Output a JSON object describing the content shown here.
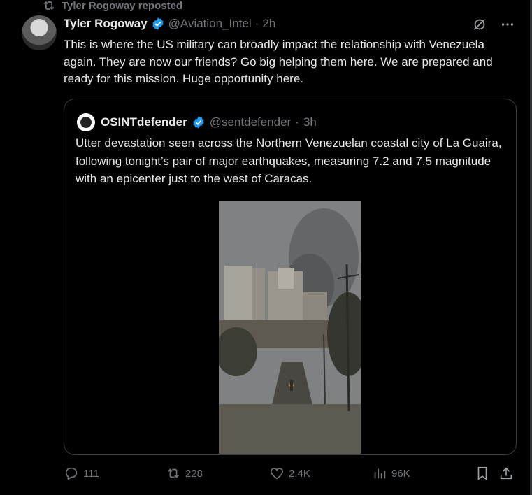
{
  "repost": {
    "label": "Tyler Rogoway reposted",
    "icon": "repost-icon"
  },
  "tweet": {
    "author_name": "Tyler Rogoway",
    "handle": "@Aviation_Intel",
    "separator": "·",
    "time": "2h",
    "text": "This is where the US military can broadly impact the relationship with Venezuela again. They are now our friends? Go big helping them here. We are prepared and ready for this mission. Huge opportunity here."
  },
  "quote": {
    "author_name": "OSINTdefender",
    "handle": "@sentdefender",
    "separator": "·",
    "time": "3h",
    "text": "Utter devastation seen across the Northern Venezuelan coastal city of La Guaira, following tonight’s pair of major earthquakes, measuring 7.2 and 7.5 magnitude with an epicenter just to the west of Caracas."
  },
  "actions": {
    "replies": "111",
    "reposts": "228",
    "likes": "2.4K",
    "views": "96K"
  },
  "colors": {
    "background": "#000000",
    "text": "#e7e9ea",
    "muted": "#71767b",
    "verified": "#1d9bf0",
    "border": "#3a3f44"
  }
}
